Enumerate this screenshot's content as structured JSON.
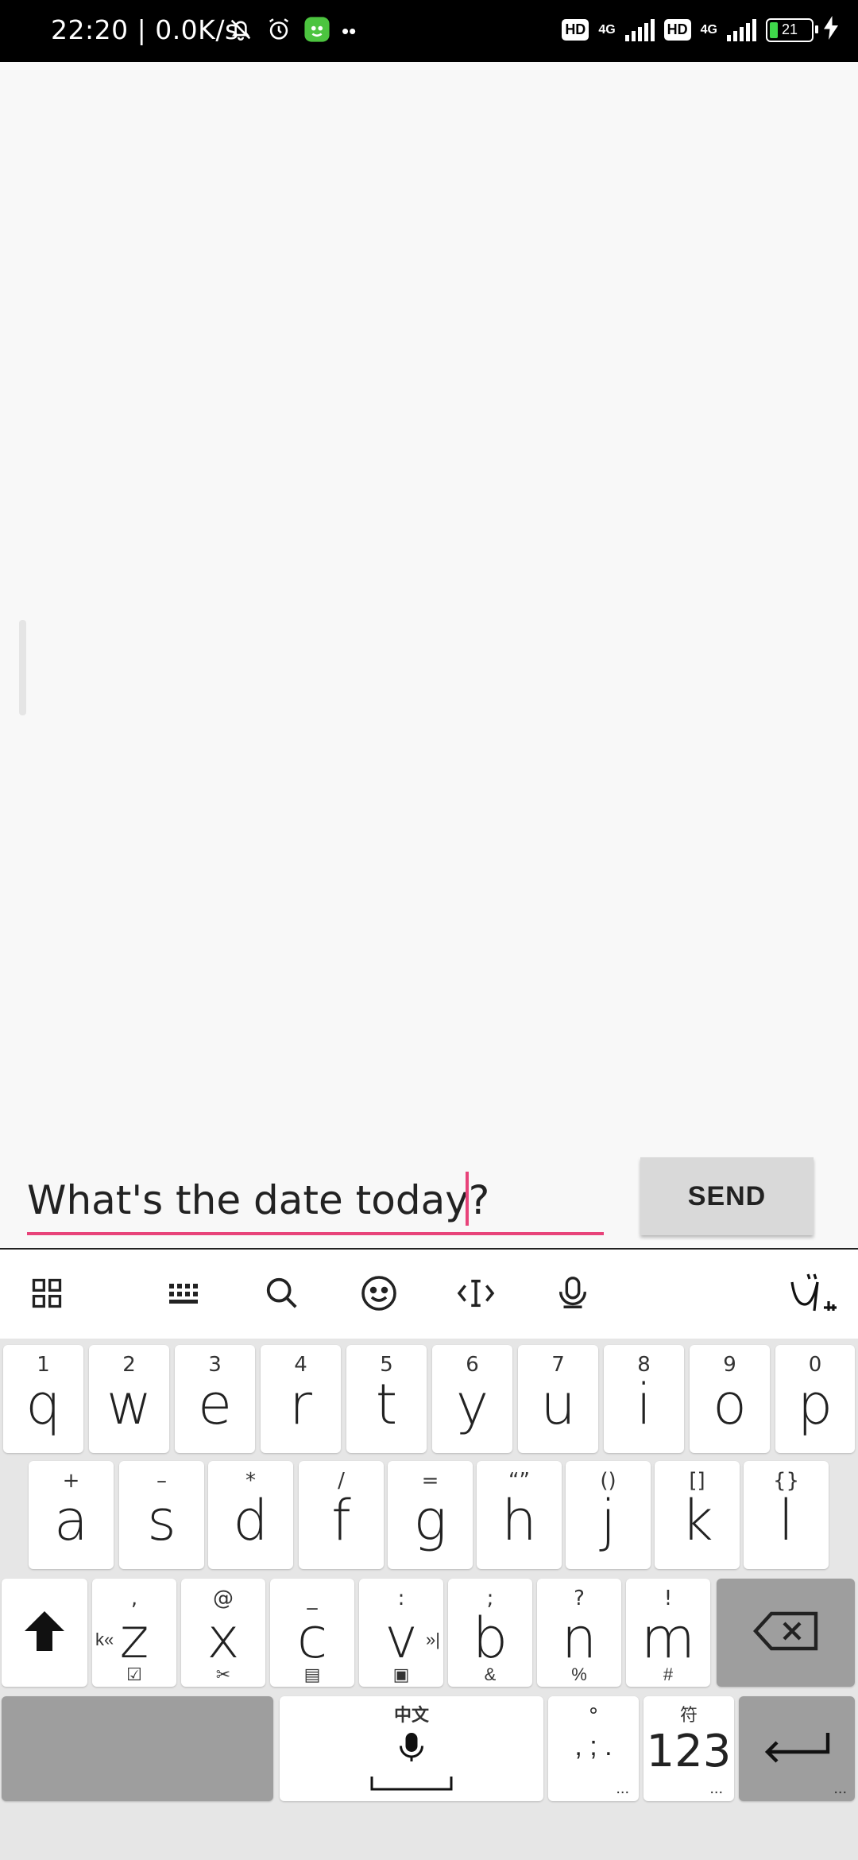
{
  "status_bar": {
    "time_speed": "22:20 | 0.0K/s",
    "hd1": "HD",
    "net1": "4G",
    "hd2": "HD",
    "net2": "4G",
    "battery": "21"
  },
  "composer": {
    "input_value": "What's the date today?",
    "send_label": "SEND"
  },
  "keyboard_toolbar": {
    "icons": [
      "grid-menu-icon",
      "keyboard-layout-icon",
      "search-icon",
      "emoji-icon",
      "cursor-move-icon",
      "voice-icon",
      "brand-logo-icon"
    ]
  },
  "keyboard": {
    "row1": [
      {
        "sub": "1",
        "main": "q"
      },
      {
        "sub": "2",
        "main": "w"
      },
      {
        "sub": "3",
        "main": "e"
      },
      {
        "sub": "4",
        "main": "r"
      },
      {
        "sub": "5",
        "main": "t"
      },
      {
        "sub": "6",
        "main": "y"
      },
      {
        "sub": "7",
        "main": "u"
      },
      {
        "sub": "8",
        "main": "i"
      },
      {
        "sub": "9",
        "main": "o"
      },
      {
        "sub": "0",
        "main": "p"
      }
    ],
    "row2": [
      {
        "sub": "+",
        "main": "a"
      },
      {
        "sub": "–",
        "main": "s"
      },
      {
        "sub": "*",
        "main": "d"
      },
      {
        "sub": "/",
        "main": "f"
      },
      {
        "sub": "=",
        "main": "g"
      },
      {
        "sub": "“”",
        "main": "h"
      },
      {
        "sub": "()",
        "main": "j"
      },
      {
        "sub": "[]",
        "main": "k"
      },
      {
        "sub": "{}",
        "main": "l"
      }
    ],
    "row3": [
      {
        "sub": ",",
        "main": "z",
        "bottom": "☑"
      },
      {
        "sub": "@",
        "main": "x",
        "bottom": "✂"
      },
      {
        "sub": "_",
        "main": "c",
        "bottom": "▤"
      },
      {
        "sub": ":",
        "main": "v",
        "bottom": "▣"
      },
      {
        "sub": ";",
        "main": "b",
        "bottom": "&"
      },
      {
        "sub": "?",
        "main": "n",
        "bottom": "%"
      },
      {
        "sub": "!",
        "main": "m",
        "bottom": "#"
      }
    ],
    "z_left_glyph": "k«",
    "v_right_glyph": "»|",
    "space_top": "中文",
    "punct_top": "°",
    "punct_mid": ", ; .",
    "punct_bottom": "...",
    "num_top": "符",
    "num_main": "123",
    "num_bottom": "...",
    "enter_bottom": "..."
  }
}
